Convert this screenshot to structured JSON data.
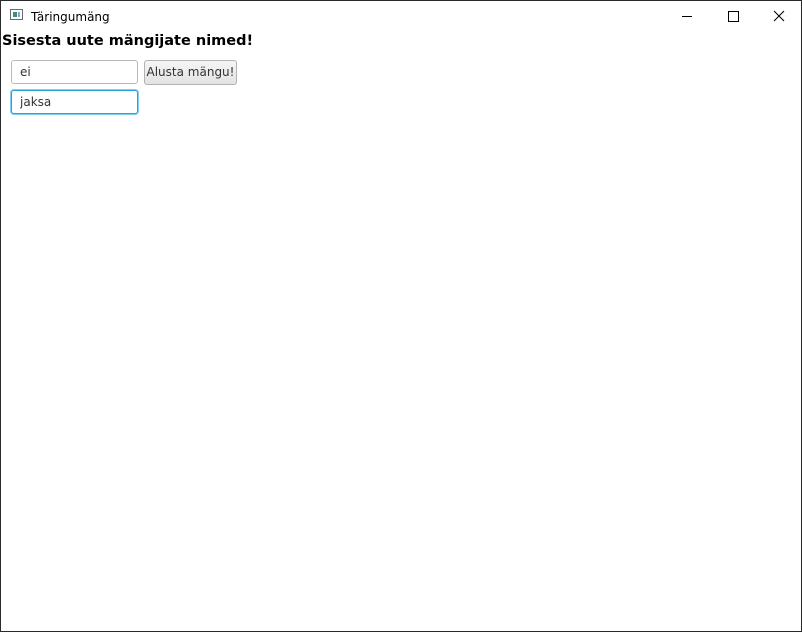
{
  "window": {
    "title": "Täringumäng",
    "icon": "app-window-icon",
    "controls": [
      "minimize-icon",
      "maximize-icon",
      "close-icon"
    ]
  },
  "main": {
    "heading": "Sisesta uute mängijate nimed!",
    "player_fields": [
      {
        "value": "ei",
        "focused": false
      },
      {
        "value": "jaksa",
        "focused": true
      }
    ],
    "start_button_label": "Alusta mängu!"
  },
  "colors": {
    "focus_border": "#2aa4d8",
    "background": "#ffffff"
  }
}
